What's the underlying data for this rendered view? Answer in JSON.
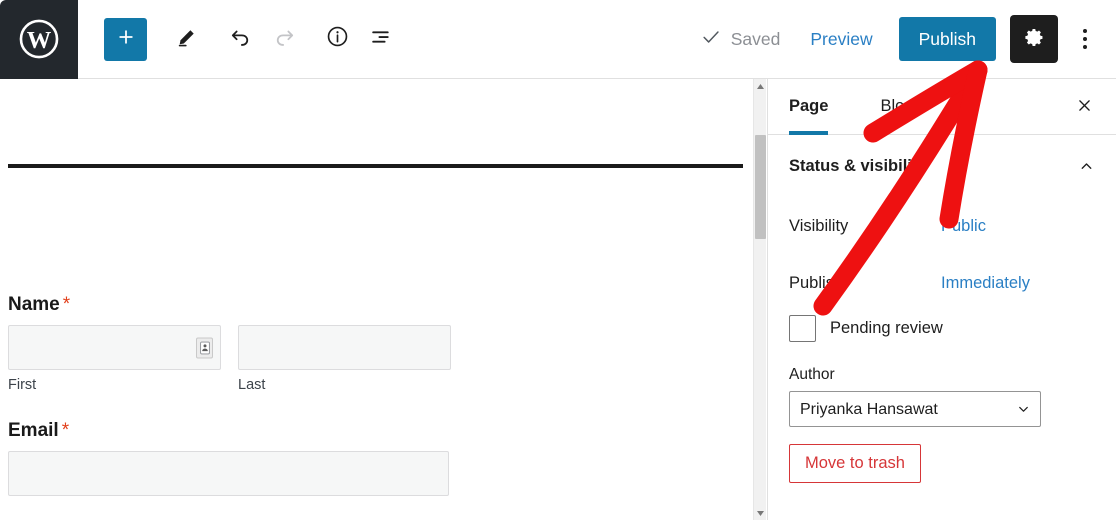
{
  "toolbar": {
    "logo_icon": "wordpress-logo-icon",
    "add_block_label": "+",
    "add_block_icon": "plus-icon",
    "edit_icon": "pencil-icon",
    "undo_icon": "undo-arrow-icon",
    "redo_icon": "redo-arrow-icon",
    "details_icon": "info-circle-icon",
    "list_view_icon": "list-view-icon",
    "saved_label": "Saved",
    "saved_check_icon": "checkmark-icon",
    "preview_label": "Preview",
    "publish_label": "Publish",
    "settings_icon": "gear-icon",
    "options_icon": "kebab-menu-icon",
    "accent_blue": "#1278a8",
    "link_blue": "#2a7fc4",
    "dark": "#1e1e1e"
  },
  "editor": {
    "fields": {
      "name": {
        "label": "Name",
        "required_marker": "*",
        "first_value": "",
        "first_sub_label": "First",
        "last_value": "",
        "last_sub_label": "Last",
        "autofill_icon": "contact-card-icon"
      },
      "email": {
        "label": "Email",
        "required_marker": "*",
        "value": ""
      }
    },
    "scrollbar": {
      "up_icon": "scroll-up-arrow-icon",
      "down_icon": "scroll-down-arrow-icon"
    }
  },
  "sidebar": {
    "tabs": [
      {
        "label": "Page",
        "active": true
      },
      {
        "label": "Block",
        "active": false
      }
    ],
    "close_icon": "close-icon",
    "panel": {
      "title": "Status & visibility",
      "collapse_icon": "chevron-up-icon",
      "rows": [
        {
          "label": "Visibility",
          "value": "Public"
        },
        {
          "label": "Publish",
          "value": "Immediately"
        }
      ],
      "pending_review": {
        "label": "Pending review",
        "checked": false
      },
      "author": {
        "label": "Author",
        "value": "Priyanka Hansawat",
        "chevron_icon": "chevron-down-icon"
      },
      "trash_label": "Move to trash",
      "trash_color": "#d63638"
    }
  },
  "annotation": {
    "type": "arrow",
    "color": "#ee1111",
    "points_to": "Publish"
  }
}
